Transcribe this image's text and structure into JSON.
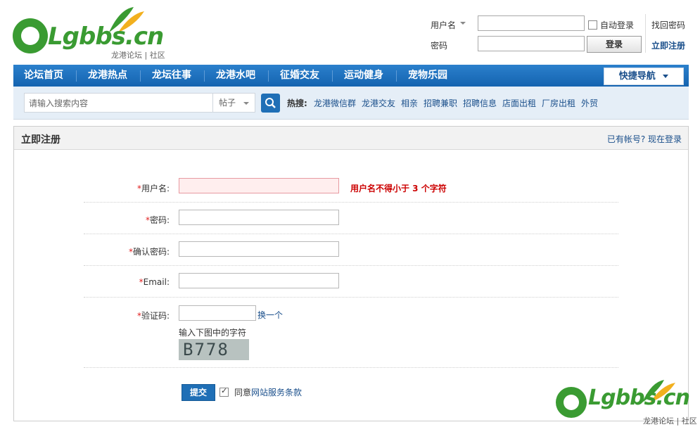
{
  "logo": {
    "text_main": "Lgbbs",
    "text_tld": ".cn",
    "subtitle": "龙港论坛 | 社区"
  },
  "login": {
    "username_label": "用户名",
    "password_label": "密码",
    "auto_login_label": "自动登录",
    "login_button": "登录",
    "forgot_password": "找回密码",
    "register_now": "立即注册"
  },
  "nav": {
    "items": [
      "论坛首页",
      "龙港热点",
      "龙坛往事",
      "龙港水吧",
      "征婚交友",
      "运动健身",
      "宠物乐园"
    ],
    "quick_nav": "快捷导航"
  },
  "search": {
    "placeholder": "请输入搜索内容",
    "type": "帖子",
    "hot_label": "热搜:",
    "hot_links": [
      "龙港微信群",
      "龙港交友",
      "相亲",
      "招聘兼职",
      "招聘信息",
      "店面出租",
      "厂房出租",
      "外贸"
    ]
  },
  "panel": {
    "title": "立即注册",
    "have_account": "已有帐号? 现在登录"
  },
  "form": {
    "username_label": "用户名:",
    "username_error": "用户名不得小于 3 个字符",
    "password_label": "密码:",
    "confirm_label": "确认密码:",
    "email_label": "Email:",
    "captcha_label": "验证码:",
    "captcha_refresh": "换一个",
    "captcha_hint": "输入下图中的字符",
    "captcha_image_text": "B778",
    "submit": "提交",
    "agree_prefix": "同意",
    "agree_link": "网站服务条款"
  },
  "watermark": {
    "text_main": "Lgbbs",
    "text_tld": ".cn",
    "subtitle": "龙港论坛 | 社区"
  },
  "colors": {
    "nav_blue": "#1b6fbe",
    "logo_green": "#3a9b32",
    "error_red": "#cc0000"
  }
}
